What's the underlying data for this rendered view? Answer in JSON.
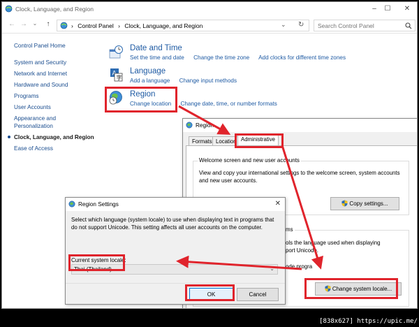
{
  "window": {
    "title": "Clock, Language, and Region",
    "controls": {
      "minimize": "–",
      "maximize": "☐",
      "close": "✕"
    }
  },
  "addressbar": {
    "nav": {
      "back": "←",
      "forward": "→",
      "recent": "⌄",
      "up": "↑"
    },
    "crumbs": [
      "Control Panel",
      "Clock, Language, and Region"
    ],
    "separator": "›",
    "dropdown": "⌄",
    "refresh": "↻",
    "search_placeholder": "Search Control Panel",
    "search_icon": "search-icon"
  },
  "sidebar": {
    "home": "Control Panel Home",
    "items": [
      "System and Security",
      "Network and Internet",
      "Hardware and Sound",
      "Programs",
      "User Accounts",
      "Appearance and Personalization"
    ],
    "current": "Clock, Language, and Region",
    "extra": [
      "Ease of Access"
    ]
  },
  "categories": {
    "datetime": {
      "title": "Date and Time",
      "links": [
        "Set the time and date",
        "Change the time zone",
        "Add clocks for different time zones"
      ]
    },
    "language": {
      "title": "Language",
      "links": [
        "Add a language",
        "Change input methods"
      ]
    },
    "region": {
      "title": "Region",
      "links": [
        "Change location",
        "Change date, time, or number formats"
      ]
    }
  },
  "region_dialog": {
    "title": "Region",
    "tabs": [
      "Formats",
      "Location",
      "Administrative"
    ],
    "active_tab": "Administrative",
    "welcome_group": {
      "title": "Welcome screen and new user accounts",
      "text": "View and copy your international settings to the welcome screen, system accounts and new user accounts.",
      "button": "Copy settings..."
    },
    "unicode_group": {
      "title_fragment": "ms",
      "text_line1": "ols the language used when displaying",
      "text_line2": "port Unicode.",
      "text_line3": "ode progra",
      "button": "Change system locale..."
    }
  },
  "region_settings_dialog": {
    "title": "Region Settings",
    "description": "Select which language (system locale) to use when displaying text in programs that do not support Unicode. This setting affects all user accounts on the computer.",
    "label": "Current system locale:",
    "selected": "Thai (Thailand)",
    "ok": "OK",
    "cancel": "Cancel",
    "close": "✕"
  },
  "colors": {
    "highlight": "#e0242c",
    "link": "#1e5aa3",
    "sidebar_link": "#1a4d8f"
  },
  "watermark": "[838x627] https://upic.me/"
}
